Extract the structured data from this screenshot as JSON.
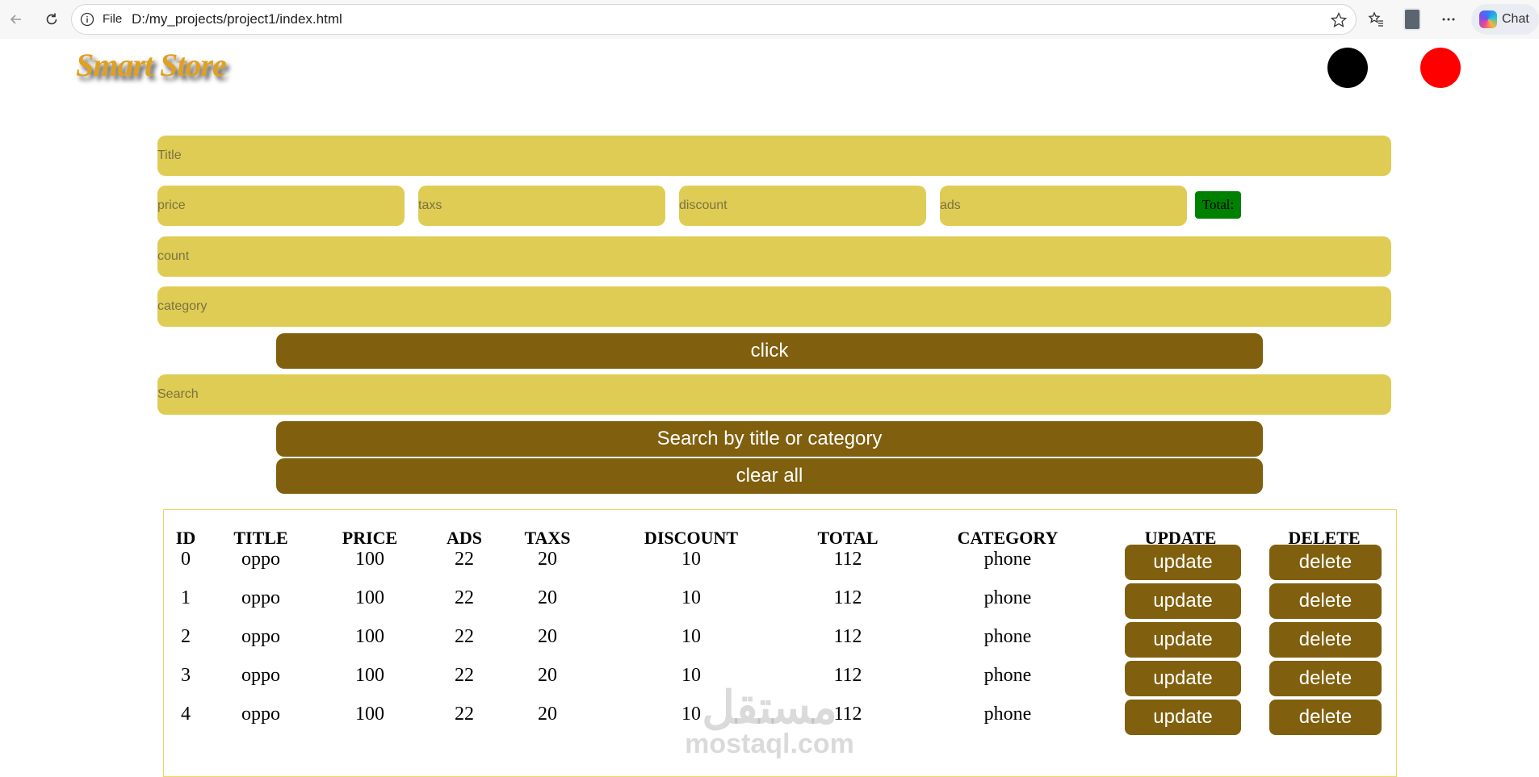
{
  "browser": {
    "scheme": "File",
    "url": "D:/my_projects/project1/index.html",
    "chat_label": "Chat",
    "icons": [
      "back-arrow-icon",
      "reload-icon",
      "info-icon",
      "star-icon",
      "favorites-icon",
      "profile-icon",
      "more-icon",
      "copilot-icon"
    ]
  },
  "header": {
    "logo": "Smart Store",
    "dark_mode_color": "#000000",
    "red_mode_color": "#ff0000"
  },
  "form": {
    "title_placeholder": "Title",
    "price_placeholder": "price",
    "taxs_placeholder": "taxs",
    "discount_placeholder": "discount",
    "ads_placeholder": "ads",
    "total_label": "Total:",
    "count_placeholder": "count",
    "category_placeholder": "category",
    "submit_label": "click",
    "search_placeholder": "Search",
    "search_button_label": "Search by title or category",
    "clear_button_label": "clear all"
  },
  "table": {
    "headers": [
      "ID",
      "TITLE",
      "PRICE",
      "ADS",
      "TAXS",
      "DISCOUNT",
      "TOTAL",
      "CATEGORY",
      "UPDATE",
      "DELETE"
    ],
    "rows": [
      {
        "id": "0",
        "title": "oppo",
        "price": "100",
        "ads": "22",
        "taxs": "20",
        "discount": "10",
        "total": "112",
        "category": "phone",
        "update": "update",
        "delete": "delete"
      },
      {
        "id": "1",
        "title": "oppo",
        "price": "100",
        "ads": "22",
        "taxs": "20",
        "discount": "10",
        "total": "112",
        "category": "phone",
        "update": "update",
        "delete": "delete"
      },
      {
        "id": "2",
        "title": "oppo",
        "price": "100",
        "ads": "22",
        "taxs": "20",
        "discount": "10",
        "total": "112",
        "category": "phone",
        "update": "update",
        "delete": "delete"
      },
      {
        "id": "3",
        "title": "oppo",
        "price": "100",
        "ads": "22",
        "taxs": "20",
        "discount": "10",
        "total": "112",
        "category": "phone",
        "update": "update",
        "delete": "delete"
      },
      {
        "id": "4",
        "title": "oppo",
        "price": "100",
        "ads": "22",
        "taxs": "20",
        "discount": "10",
        "total": "112",
        "category": "phone",
        "update": "update",
        "delete": "delete"
      }
    ]
  },
  "watermark": {
    "logo": "مستقل",
    "text": "mostaql.com"
  },
  "colors": {
    "input_bg": "#dfcc54",
    "button_bg": "#80600e",
    "total_bg": "#008000",
    "logo": "#e0a020"
  }
}
